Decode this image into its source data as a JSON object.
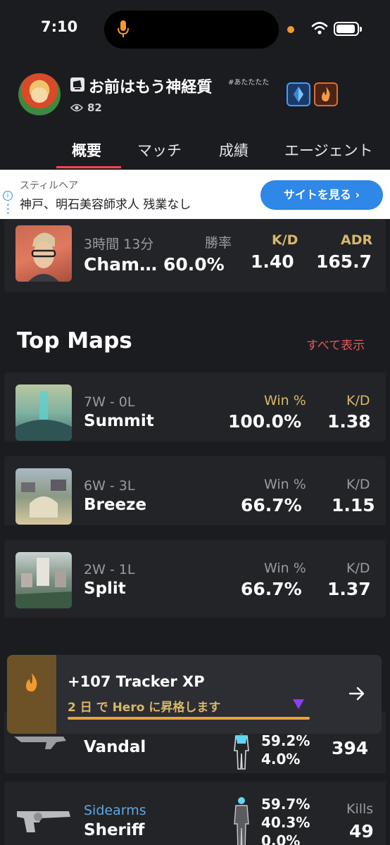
{
  "status_bar": {
    "time": "7:10"
  },
  "profile": {
    "username": "お前はもう神経質",
    "tag": "#あたたたた",
    "views": "82"
  },
  "tabs": [
    {
      "label": "概要"
    },
    {
      "label": "マッチ"
    },
    {
      "label": "成績"
    },
    {
      "label": "エージェント"
    }
  ],
  "ad": {
    "subtitle": "スティルヘア",
    "title": "神戸、明石美容師求人 残業なし",
    "button": "サイトを見る"
  },
  "agent_card": {
    "time": "3時間 13分",
    "name": "Cham…",
    "winrate_label": "勝率",
    "winrate": "60.0%",
    "kd_label": "K/D",
    "kd": "1.40",
    "adr_label": "ADR",
    "adr": "165.7"
  },
  "top_maps": {
    "title": "Top Maps",
    "view_all": "すべて表示",
    "maps": [
      {
        "record": "7W - 0L",
        "name": "Summit",
        "win_label": "Win %",
        "win": "100.0%",
        "kd_label": "K/D",
        "kd": "1.38"
      },
      {
        "record": "6W - 3L",
        "name": "Breeze",
        "win_label": "Win %",
        "win": "66.7%",
        "kd_label": "K/D",
        "kd": "1.15"
      },
      {
        "record": "2W - 1L",
        "name": "Split",
        "win_label": "Win %",
        "win": "66.7%",
        "kd_label": "K/D",
        "kd": "1.37"
      }
    ]
  },
  "xp_banner": {
    "title": "+107 Tracker XP",
    "subtitle_prefix": "2 日 で Hero に昇格します",
    "progress": 1.0
  },
  "weapons": [
    {
      "category": "",
      "name": "Vandal",
      "p1": "59.2%",
      "p2": "4.0%",
      "p3": "",
      "kills_label": "",
      "kills": "394"
    },
    {
      "category": "Sidearms",
      "name": "Sheriff",
      "p1": "59.7%",
      "p2": "40.3%",
      "p3": "0.0%",
      "kills_label": "Kills",
      "kills": "49"
    }
  ],
  "colors": {
    "accent": "#ff4655",
    "gold": "#d8b869",
    "background": "#1b1c20",
    "card": "#232428"
  }
}
